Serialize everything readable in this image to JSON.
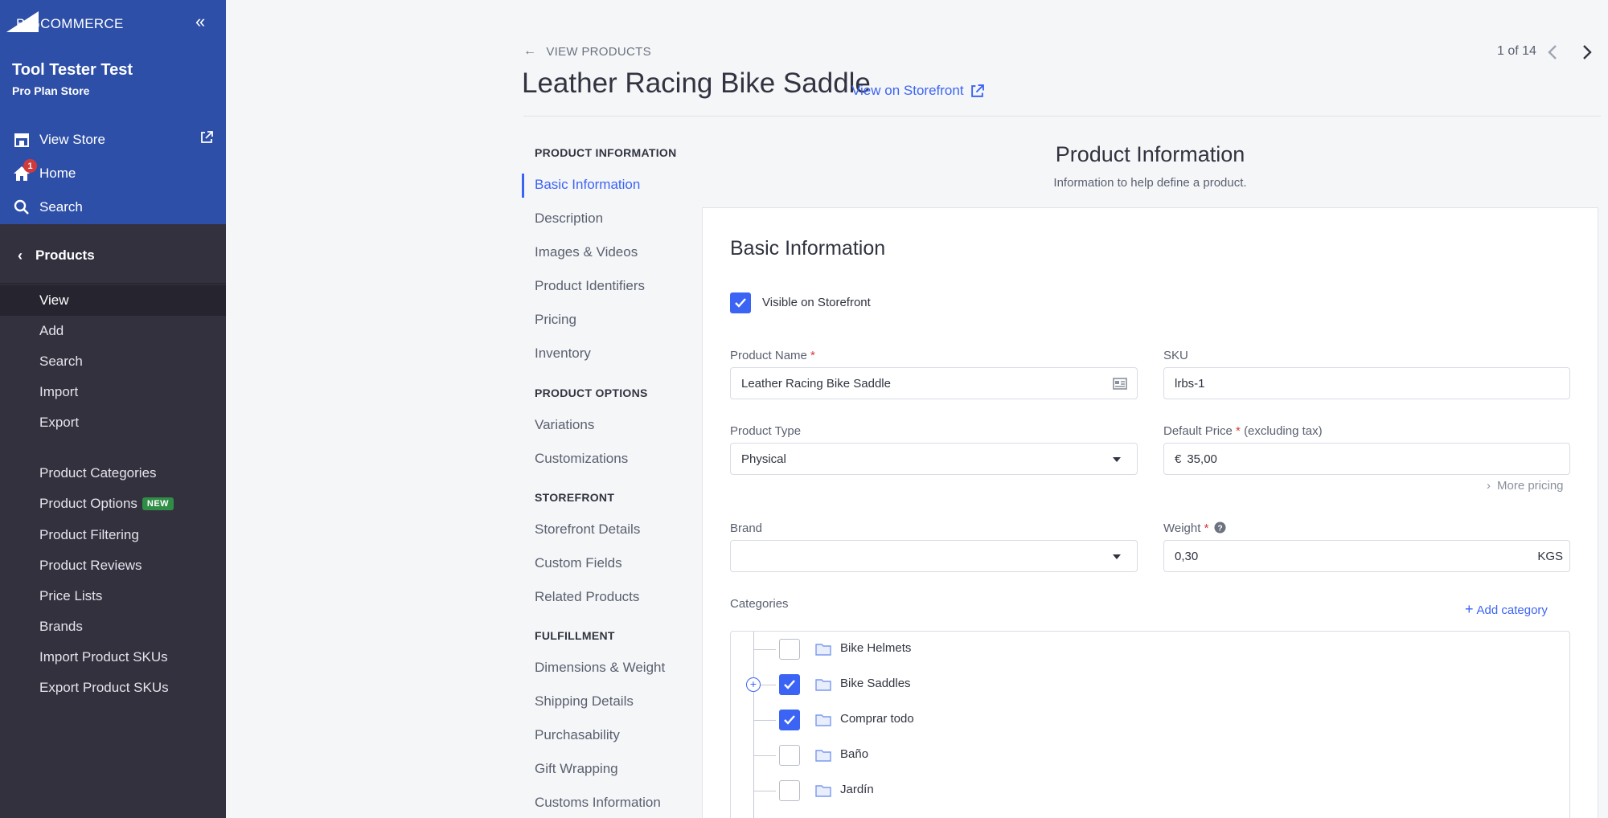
{
  "brand": {
    "logo_text": "BIGCOMMERCE"
  },
  "store": {
    "name": "Tool Tester Test",
    "plan": "Pro Plan Store"
  },
  "top_nav": [
    {
      "label": "View Store",
      "icon": "storefront-icon"
    },
    {
      "label": "Home",
      "icon": "home-icon",
      "badge": "1"
    },
    {
      "label": "Search",
      "icon": "search-icon"
    }
  ],
  "section": {
    "label": "Products"
  },
  "sub_nav": [
    {
      "label": "View",
      "active": true
    },
    {
      "label": "Add"
    },
    {
      "label": "Search"
    },
    {
      "label": "Import"
    },
    {
      "label": "Export"
    },
    {
      "label": "Product Categories"
    },
    {
      "label": "Product Options",
      "badge": "NEW"
    },
    {
      "label": "Product Filtering"
    },
    {
      "label": "Product Reviews"
    },
    {
      "label": "Price Lists"
    },
    {
      "label": "Brands"
    },
    {
      "label": "Import Product SKUs"
    },
    {
      "label": "Export Product SKUs"
    }
  ],
  "header": {
    "back_label": "VIEW PRODUCTS",
    "title": "Leather Racing Bike Saddle",
    "view_storefront": "View on Storefront",
    "pager": "1 of 14"
  },
  "section_nav": {
    "groups": [
      {
        "heading": "PRODUCT INFORMATION",
        "items": [
          "Basic Information",
          "Description",
          "Images & Videos",
          "Product Identifiers",
          "Pricing",
          "Inventory"
        ]
      },
      {
        "heading": "PRODUCT OPTIONS",
        "items": [
          "Variations",
          "Customizations"
        ]
      },
      {
        "heading": "STOREFRONT",
        "items": [
          "Storefront Details",
          "Custom Fields",
          "Related Products"
        ]
      },
      {
        "heading": "FULFILLMENT",
        "items": [
          "Dimensions & Weight",
          "Shipping Details",
          "Purchasability",
          "Gift Wrapping",
          "Customs Information"
        ]
      }
    ],
    "active": "Basic Information"
  },
  "product_info": {
    "title": "Product Information",
    "subtitle": "Information to help define a product."
  },
  "basic": {
    "title": "Basic Information",
    "visible_label": "Visible on Storefront",
    "visible_checked": true,
    "product_name_label": "Product Name",
    "product_name_value": "Leather Racing Bike Saddle",
    "sku_label": "SKU",
    "sku_value": "lrbs-1",
    "product_type_label": "Product Type",
    "product_type_value": "Physical",
    "price_label": "Default Price",
    "price_suffix": "(excluding tax)",
    "currency": "€",
    "price_value": "35,00",
    "more_pricing": "More pricing",
    "brand_label": "Brand",
    "brand_value": "",
    "weight_label": "Weight",
    "weight_value": "0,30",
    "weight_unit": "KGS",
    "categories_label": "Categories",
    "add_category": "Add category",
    "categories": [
      {
        "name": "Bike Helmets",
        "checked": false
      },
      {
        "name": "Bike Saddles",
        "checked": true,
        "expandable": true
      },
      {
        "name": "Comprar todo",
        "checked": true
      },
      {
        "name": "Baño",
        "checked": false
      },
      {
        "name": "Jardín",
        "checked": false
      }
    ]
  },
  "colors": {
    "sidebar_top": "#2d4fa8",
    "sidebar": "#34313f",
    "accent": "#3c64f4",
    "badge_red": "#d13a3a",
    "new_green": "#2f8d46"
  }
}
